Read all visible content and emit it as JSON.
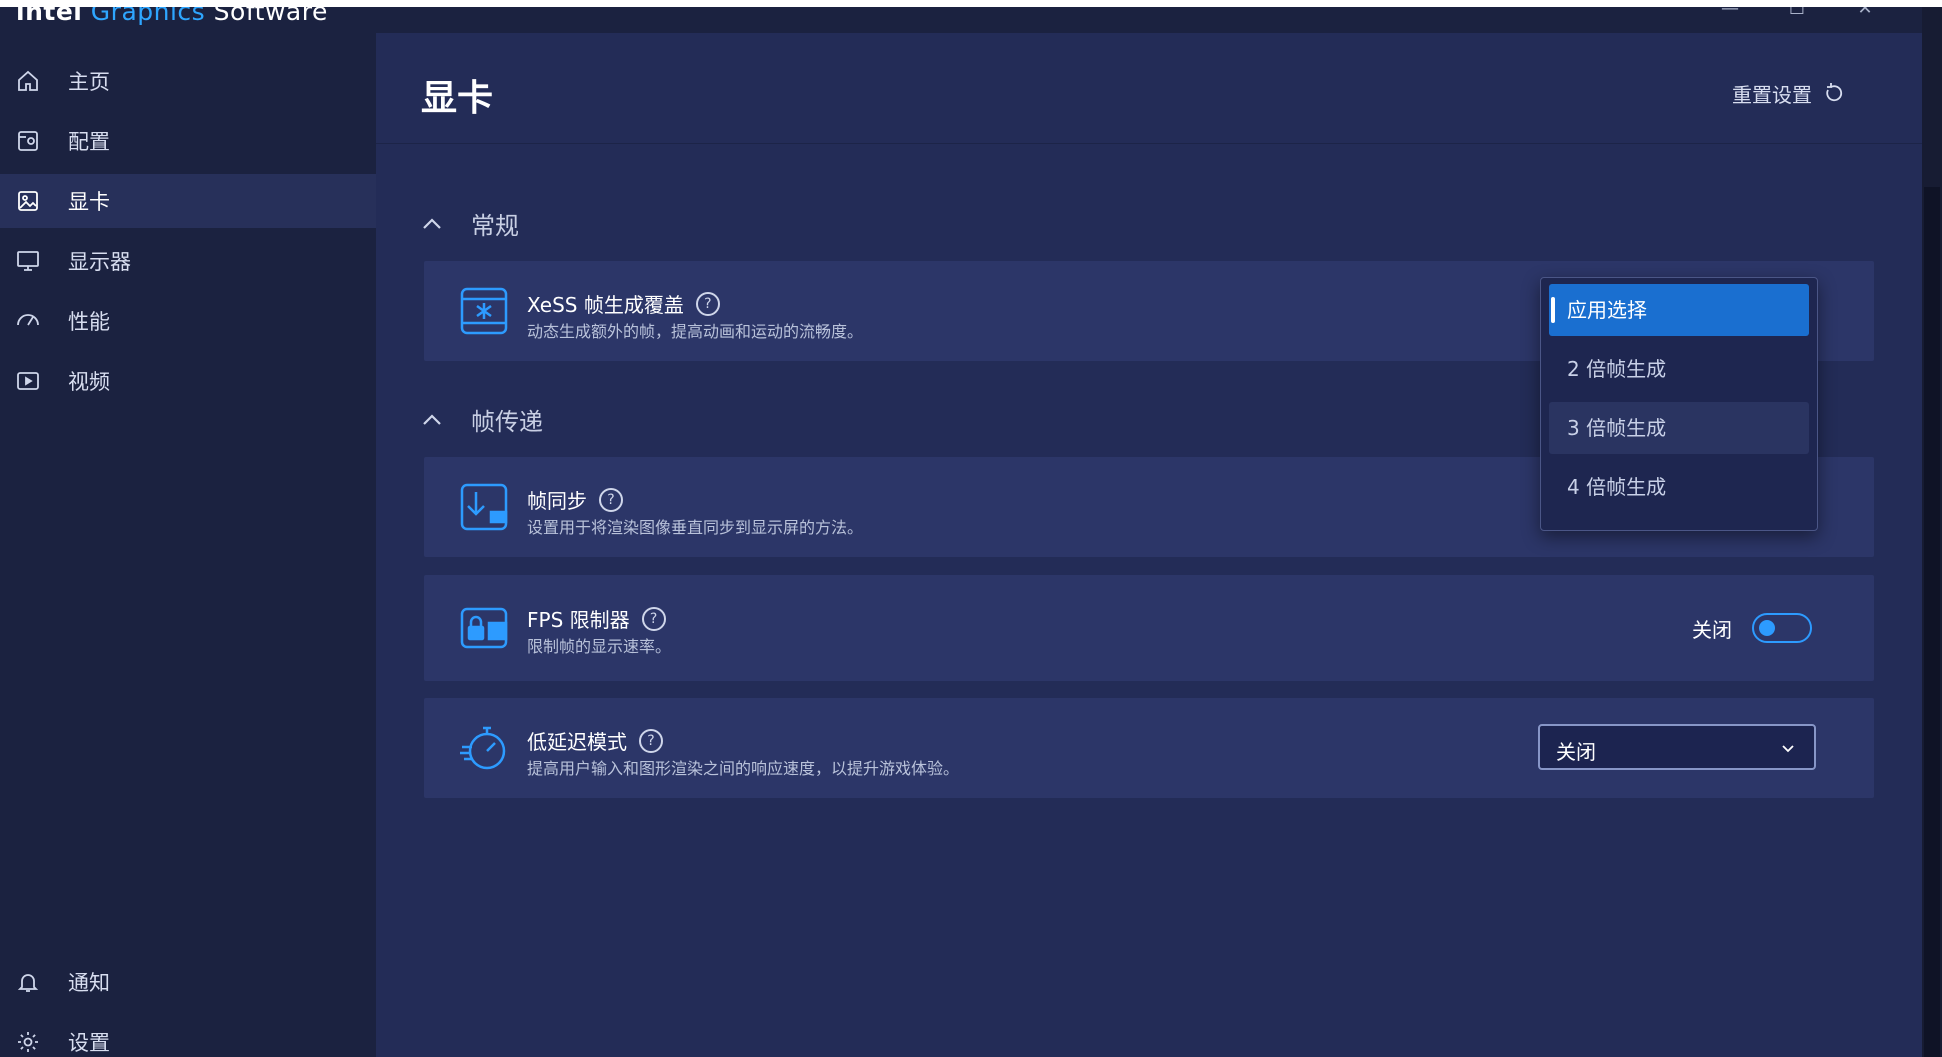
{
  "app": {
    "brand_part1": "intel",
    "brand_part2": "Graphics",
    "brand_part3": "Software",
    "window_controls": [
      "—",
      "☐",
      "✕"
    ]
  },
  "sidebar": {
    "items": [
      {
        "label": "主页",
        "icon": "home-icon"
      },
      {
        "label": "配置",
        "icon": "profile-icon"
      },
      {
        "label": "显卡",
        "icon": "graphics-icon",
        "active": true
      },
      {
        "label": "显示器",
        "icon": "monitor-icon"
      },
      {
        "label": "性能",
        "icon": "performance-gauge-icon"
      },
      {
        "label": "视频",
        "icon": "video-play-icon"
      }
    ],
    "bottom_items": [
      {
        "label": "通知",
        "icon": "bell-icon"
      },
      {
        "label": "设置",
        "icon": "gear-icon"
      }
    ]
  },
  "main": {
    "title": "显卡",
    "reset_label": "重置设置",
    "sections": [
      {
        "label": "常规",
        "cards": [
          {
            "title": "XeSS 帧生成覆盖",
            "description": "动态生成额外的帧，提高动画和运动的流畅度。",
            "icon": "xess-frame-generation-icon"
          }
        ]
      },
      {
        "label": "帧传递",
        "cards": [
          {
            "title": "帧同步",
            "description": "设置用于将渲染图像垂直同步到显示屏的方法。",
            "icon": "frame-sync-icon"
          },
          {
            "title": "FPS 限制器",
            "description": "限制帧的显示速率。",
            "icon": "fps-limiter-icon",
            "toggle_label": "关闭",
            "toggle_on": false
          },
          {
            "title": "低延迟模式",
            "description": "提高用户输入和图形渲染之间的响应速度，以提升游戏体验。",
            "icon": "low-latency-stopwatch-icon",
            "select_value": "关闭"
          }
        ]
      }
    ],
    "dropdown_options": [
      "应用选择",
      "2 倍帧生成",
      "3 倍帧生成",
      "4 倍帧生成"
    ],
    "dropdown_selected": "应用选择"
  },
  "colors": {
    "accent": "#2d9bff",
    "selected_option": "#1a6fd0",
    "card_bg": "#2c3668",
    "main_bg": "#232c57",
    "sidebar_bg": "#1b2240"
  }
}
